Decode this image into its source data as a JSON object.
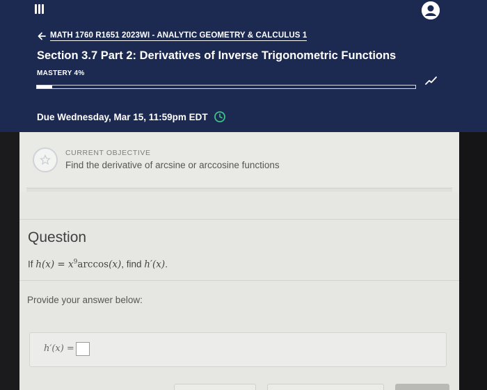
{
  "header": {
    "course_breadcrumb": "MATH 1760 R1651 2023WI - ANALYTIC GEOMETRY & CALCULUS 1",
    "title": "Section 3.7 Part 2: Derivatives of Inverse Trigonometric Functions",
    "mastery_label": "MASTERY 4%",
    "mastery_progress": 0.04,
    "due": "Due Wednesday, Mar 15, 11:59pm EDT"
  },
  "objective": {
    "label": "CURRENT OBJECTIVE",
    "text": "Find the derivative of arcsine or arccosine functions"
  },
  "question": {
    "heading": "Question",
    "prompt_if": "If",
    "prompt_h": "h",
    "prompt_x1": "(x) = x",
    "prompt_exp": "9",
    "prompt_arc": "arccos",
    "prompt_x2": "(x)",
    "prompt_find": ", find",
    "prompt_hp": "h′(x)",
    "prompt_end": ".",
    "answer_prompt": "Provide your answer below:",
    "answer_lhs": "h′(x) ="
  },
  "colors": {
    "header_bg": "#1c2a52",
    "panel_bg": "#e6e6e3",
    "accent_white": "#ffffff",
    "clock_green": "#3cc28a"
  },
  "icons": [
    "menu-icon",
    "user-avatar-icon",
    "back-arrow-icon",
    "trend-icon",
    "clock-icon",
    "star-icon"
  ]
}
